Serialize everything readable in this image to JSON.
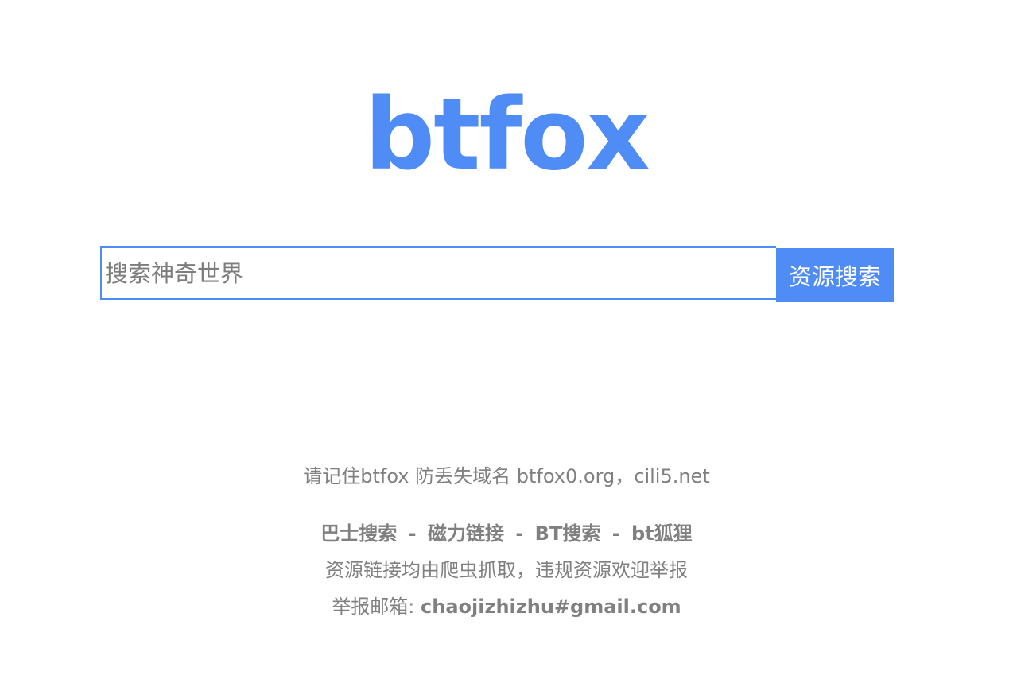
{
  "logo": {
    "text": "btfox",
    "color": "#4f8cf6"
  },
  "search": {
    "placeholder": "搜索神奇世界",
    "value": "",
    "button_label": "资源搜索",
    "accent_color": "#4f8cf6"
  },
  "footer": {
    "notice": "请记住btfox 防丢失域名 btfox0.org，cili5.net",
    "links": [
      {
        "label": "巴士搜索"
      },
      {
        "label": "磁力链接"
      },
      {
        "label": "BT搜索"
      },
      {
        "label": "bt狐狸"
      }
    ],
    "separator": "-",
    "disclaimer": "资源链接均由爬虫抓取，违规资源欢迎举报",
    "report_label": "举报邮箱: ",
    "report_email": "chaojizhizhu#gmail.com",
    "text_color": "#808080"
  }
}
